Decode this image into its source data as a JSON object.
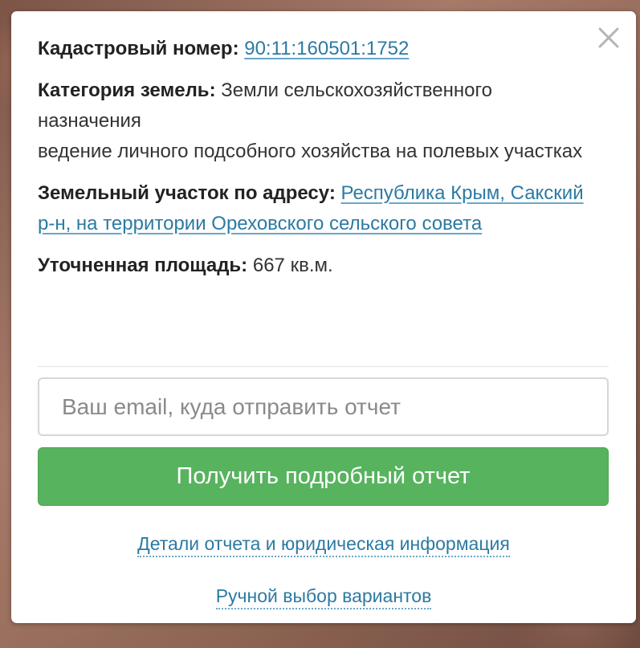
{
  "cadastral": {
    "label": "Кадастровый номер:",
    "number": "90:11:160501:1752"
  },
  "category": {
    "label": "Категория земель:",
    "value": "Земли сельскохозяйственного назначения",
    "usage": "ведение личного подсобного хозяйства на полевых участках"
  },
  "address": {
    "label": "Земельный участок по адресу:",
    "value": "Республика Крым, Сакский р-н, на территории Ореховского сельского совета"
  },
  "area": {
    "label": "Уточненная площадь:",
    "value": "667 кв.м."
  },
  "email_input": {
    "placeholder": "Ваш email, куда отправить отчет",
    "value": ""
  },
  "submit_button": {
    "label": "Получить подробный отчет"
  },
  "links": {
    "report_details": "Детали отчета и юридическая информация",
    "manual_choice": "Ручной выбор вариантов"
  },
  "icons": {
    "close": "close-icon"
  },
  "colors": {
    "link": "#2c7aa3",
    "button": "#58b35e",
    "text": "#333333"
  }
}
